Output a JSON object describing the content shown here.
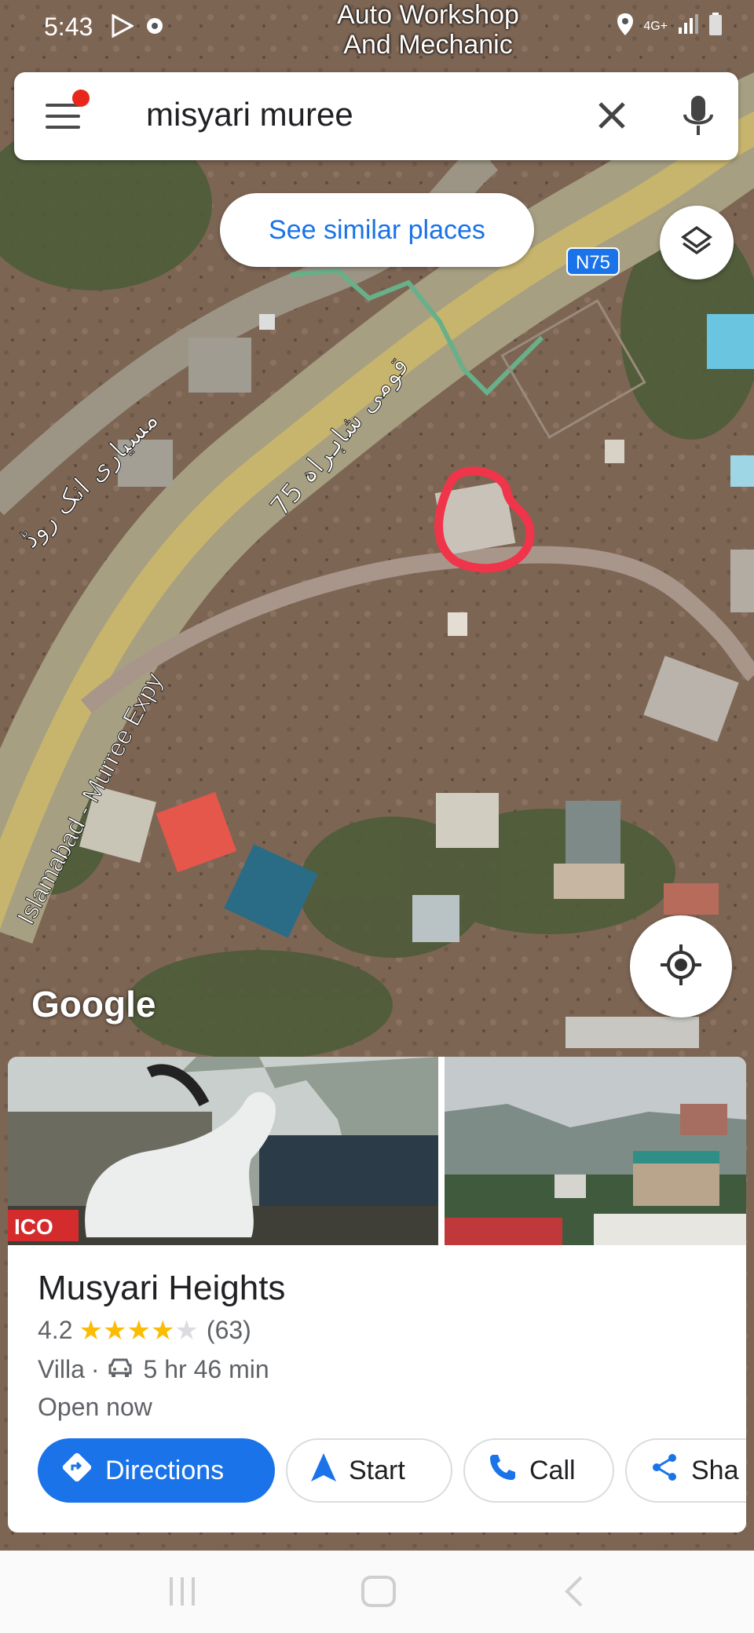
{
  "status_bar": {
    "time": "5:43",
    "network": "4G+",
    "icons": [
      "play-store-icon",
      "settings-icon",
      "location-icon",
      "signal-icon",
      "battery-icon"
    ]
  },
  "map": {
    "poi_label_line1": "Auto Workshop",
    "poi_label_line2": "And Mechanic",
    "road_shield": "N75",
    "road_label_expy": "Islamabad - Murree Expy",
    "road_label_urdu1": "مسیاری انک روڈ",
    "road_label_urdu2": "75 قومی شاہراہ",
    "attribution": "Google"
  },
  "search": {
    "query": "misyari muree"
  },
  "buttons": {
    "similar": "See similar places"
  },
  "place": {
    "name": "Musyari Heights",
    "rating": "4.2",
    "rating_value": 4.2,
    "review_count": "(63)",
    "category": "Villa",
    "separator": "·",
    "drive_time": "5 hr 46 min",
    "status": "Open now",
    "photo_banner_text": "ICO"
  },
  "actions": {
    "directions": "Directions",
    "start": "Start",
    "call": "Call",
    "share": "Sha"
  },
  "colors": {
    "accent": "#1a73e8",
    "star": "#fbbc04",
    "star_empty": "#dadce0",
    "highlight_circle": "#f0344a"
  }
}
